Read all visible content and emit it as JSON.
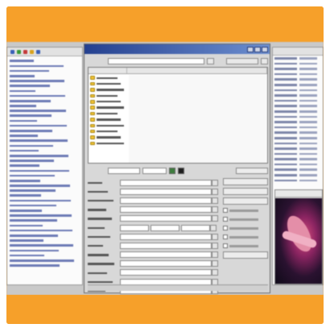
{
  "colors": {
    "border_orange": "#f39a1e",
    "titlebar_blue": "#24408f",
    "folder_yellow": "#f2c233"
  },
  "dialog": {
    "toolbar_icons": [
      "minimize-icon",
      "maximize-icon",
      "close-icon"
    ],
    "file_list_rows": 12,
    "form_fields": 15
  },
  "icons": [
    "folder-icon",
    "play-icon",
    "stop-icon"
  ]
}
